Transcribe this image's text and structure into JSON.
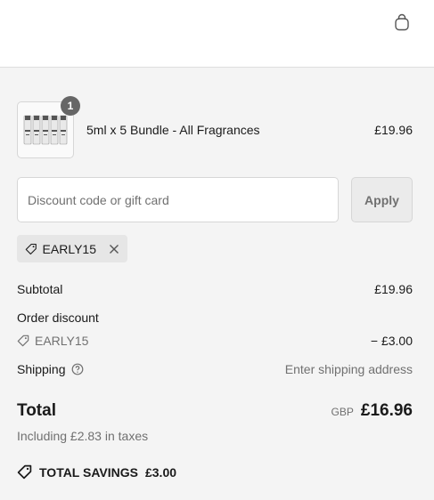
{
  "header": {
    "cart_icon": "shopping-bag-icon"
  },
  "line_item": {
    "quantity": "1",
    "title": "5ml x 5 Bundle - All Fragrances",
    "price": "£19.96"
  },
  "discount": {
    "placeholder": "Discount code or gift card",
    "apply_label": "Apply",
    "applied_code": "EARLY15"
  },
  "totals": {
    "subtotal_label": "Subtotal",
    "subtotal_value": "£19.96",
    "order_discount_label": "Order discount",
    "discount_code": "EARLY15",
    "discount_value": "− £3.00",
    "shipping_label": "Shipping",
    "shipping_value": "Enter shipping address",
    "total_label": "Total",
    "currency": "GBP",
    "total_value": "£16.96",
    "taxes_note": "Including £2.83 in taxes"
  },
  "savings": {
    "label": "TOTAL SAVINGS",
    "value": "£3.00"
  },
  "colors": {
    "background": "#f4f4f4",
    "badge": "#666666",
    "muted": "#707070"
  }
}
